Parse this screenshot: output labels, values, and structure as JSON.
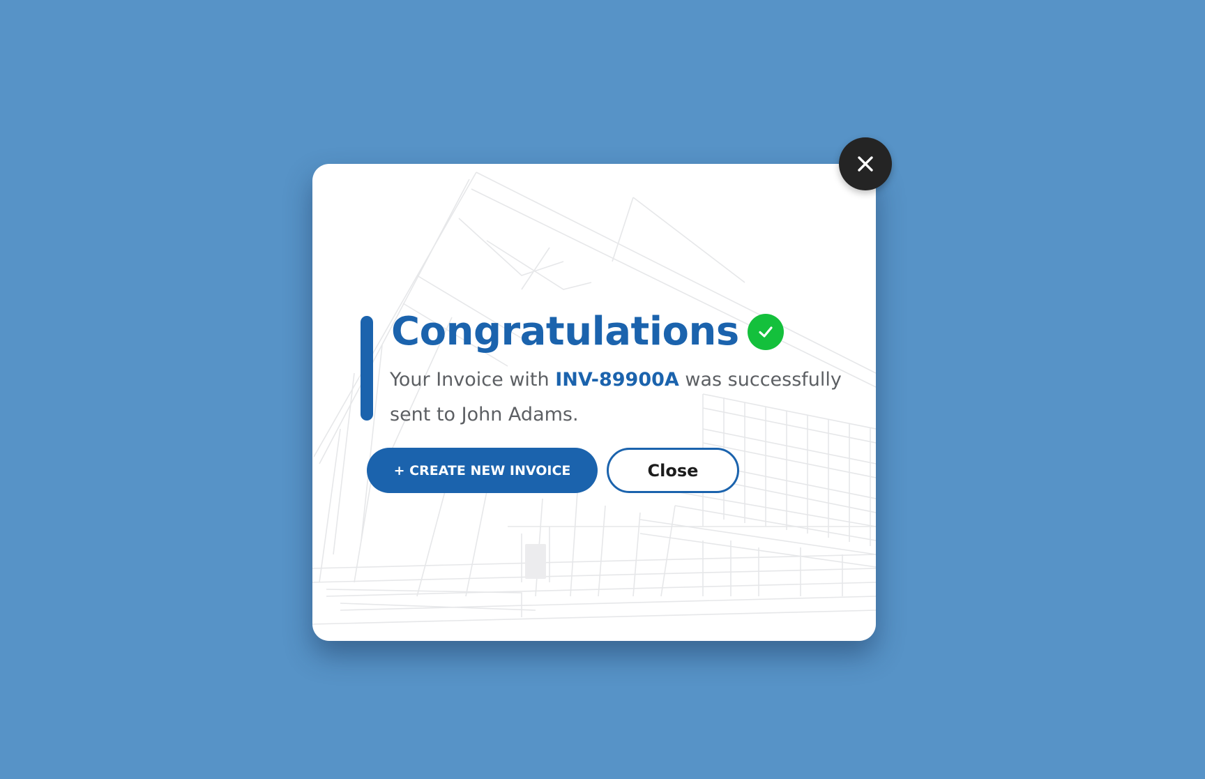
{
  "modal": {
    "title": "Congratulations",
    "message_prefix": "Your Invoice with ",
    "invoice_number": "INV-89900A",
    "message_suffix": " was successfully sent to John Adams.",
    "primary_button_label": "+ CREATE NEW INVOICE",
    "secondary_button_label": "Close",
    "close_icon": "close-x-icon",
    "success_icon": "checkmark-icon",
    "background_art": "building-sketch"
  },
  "colors": {
    "page_background": "#5793c7",
    "brand_blue": "#1b63ad",
    "success_green": "#14c03c",
    "close_button": "#242424",
    "body_text": "#5c5f63"
  }
}
